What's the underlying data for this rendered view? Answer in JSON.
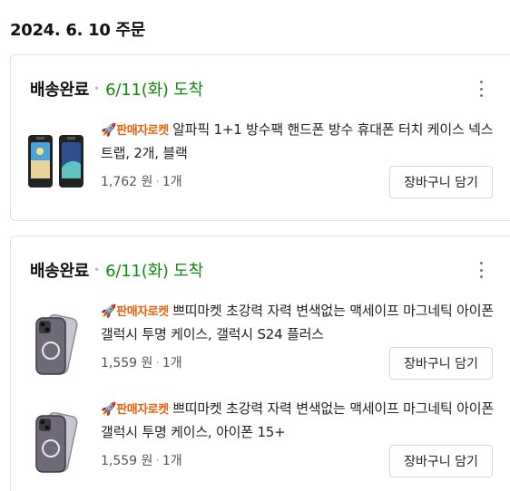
{
  "order": {
    "date_label": "2024. 6. 10 주문"
  },
  "groups": [
    {
      "status": "배송완료",
      "dot": "•",
      "arrival": "6/11(화) 도착",
      "items": [
        {
          "rocket_icon": "rocket-icon",
          "badge": "판매자로켓",
          "title": "알파픽 1+1 방수팩 핸드폰 방수 휴대폰 터치 케이스 넥스트랩, 2개, 블랙",
          "price": "1,762 원",
          "qty": "1개",
          "cart_label": "장바구니 담기"
        }
      ]
    },
    {
      "status": "배송완료",
      "dot": "•",
      "arrival": "6/11(화) 도착",
      "items": [
        {
          "rocket_icon": "rocket-icon",
          "badge": "판매자로켓",
          "title": "쁘띠마켓 초강력 자력 변색없는 맥세이프 마그네틱 아이폰 갤럭시 투명 케이스, 갤럭시 S24 플러스",
          "price": "1,559 원",
          "qty": "1개",
          "cart_label": "장바구니 담기"
        },
        {
          "rocket_icon": "rocket-icon",
          "badge": "판매자로켓",
          "title": "쁘띠마켓 초강력 자력 변색없는 맥세이프 마그네틱 아이폰 갤럭시 투명 케이스, 아이폰 15+",
          "price": "1,559 원",
          "qty": "1개",
          "cart_label": "장바구니 담기"
        }
      ]
    }
  ],
  "colors": {
    "arrival_green": "#118811",
    "badge_orange": "#e8620c"
  }
}
